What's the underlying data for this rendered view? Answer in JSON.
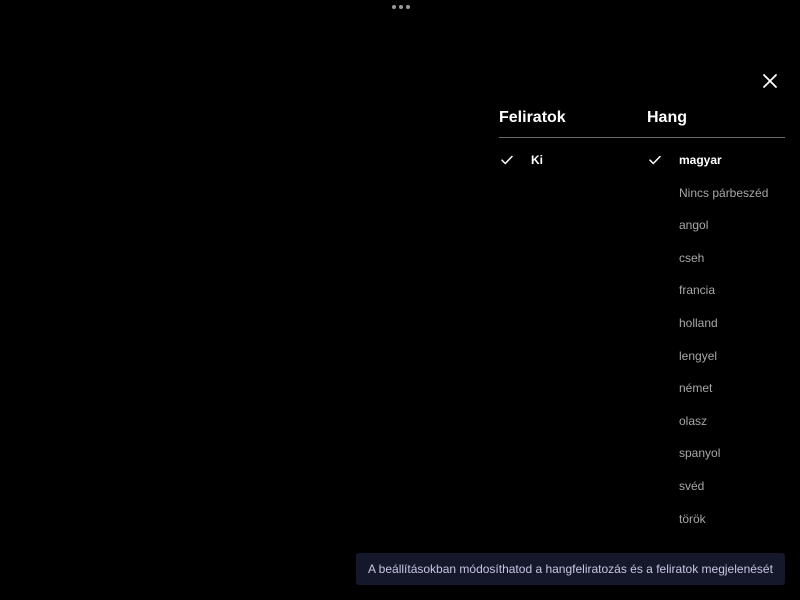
{
  "window": {
    "more_icon": "ellipsis-icon",
    "close_icon": "close-icon"
  },
  "tabs": {
    "subtitles_label": "Feliratok",
    "audio_label": "Hang"
  },
  "subtitles": {
    "options": [
      {
        "label": "Ki",
        "selected": true
      }
    ]
  },
  "audio": {
    "options": [
      {
        "label": "magyar",
        "selected": true
      },
      {
        "label": "Nincs párbeszéd",
        "selected": false
      },
      {
        "label": "angol",
        "selected": false
      },
      {
        "label": "cseh",
        "selected": false
      },
      {
        "label": "francia",
        "selected": false
      },
      {
        "label": "holland",
        "selected": false
      },
      {
        "label": "lengyel",
        "selected": false
      },
      {
        "label": "német",
        "selected": false
      },
      {
        "label": "olasz",
        "selected": false
      },
      {
        "label": "spanyol",
        "selected": false
      },
      {
        "label": "svéd",
        "selected": false
      },
      {
        "label": "török",
        "selected": false
      }
    ]
  },
  "toast": {
    "message": "A beállításokban módosíthatod a hangfeliratozás és a feliratok megjelenését"
  },
  "colors": {
    "background": "#000000",
    "selected_text": "#ffffff",
    "option_text": "#a7a7a7",
    "divider": "#6b6b6b",
    "toast_background": "#15172b",
    "toast_text": "#c7c7e3"
  }
}
